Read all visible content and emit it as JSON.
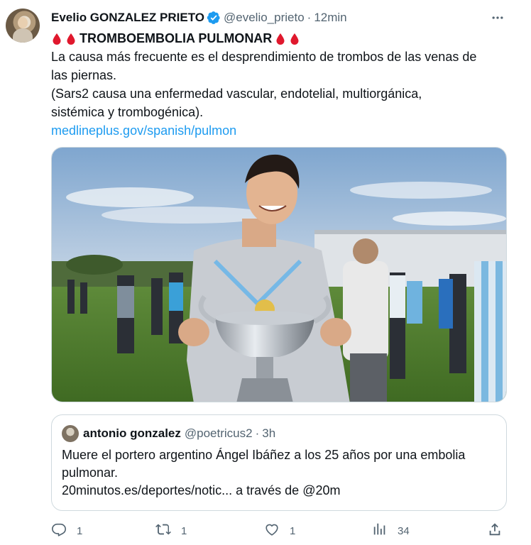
{
  "tweet": {
    "author": {
      "display_name": "Evelio GONZALEZ PRIETO",
      "handle": "@evelio_prieto",
      "separator": "·",
      "time": "12min"
    },
    "headline": "TROMBOEMBOLIA PULMONAR",
    "body_line1": "La causa más frecuente es el desprendimiento de trombos de las venas de",
    "body_line2": "las piernas.",
    "body_line3": "(Sars2 causa una enfermedad vascular, endotelial, multiorgánica,",
    "body_line4": "sistémica y trombogénica).",
    "link": "medlineplus.gov/spanish/pulmon",
    "icons": {
      "verified": "verified-badge-icon",
      "drop": "blood-drop-icon",
      "more": "more-options-icon"
    },
    "colors": {
      "link": "#1d9bf0",
      "secondary_text": "#536471",
      "drop": "#e0182d",
      "verified": "#1d9bf0"
    }
  },
  "quote": {
    "display_name": "antonio gonzalez",
    "handle": "@poetricus2",
    "separator": "·",
    "time": "3h",
    "text_line1": "Muere el portero argentino Ángel Ibáñez a los 25 años por una embolia",
    "text_line2": "pulmonar.",
    "text_line3": "20minutos.es/deportes/notic... a través de @20m"
  },
  "actions": {
    "reply_count": "1",
    "retweet_count": "1",
    "like_count": "1",
    "views_count": "34",
    "icons": [
      "reply-icon",
      "retweet-icon",
      "like-icon",
      "views-icon",
      "share-icon"
    ]
  }
}
